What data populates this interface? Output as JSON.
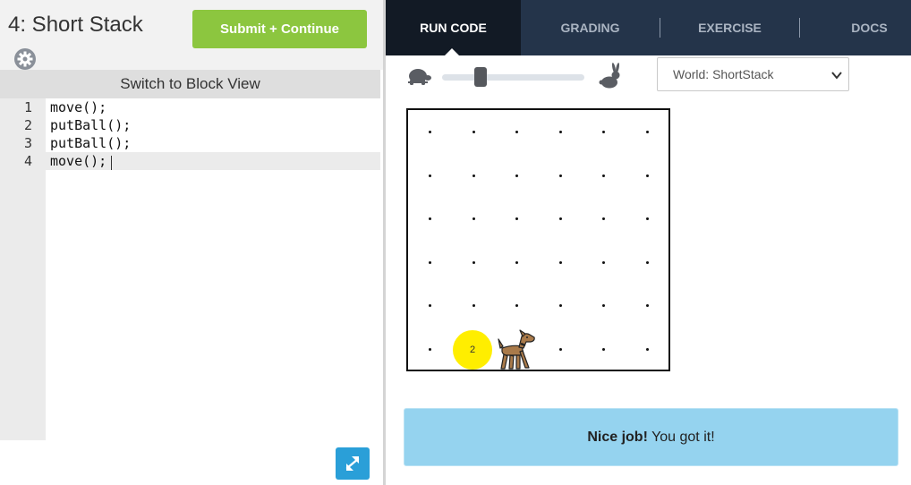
{
  "lesson": {
    "title": "4: Short Stack",
    "submit_label": "Submit + Continue",
    "switch_view_label": "Switch to Block View"
  },
  "editor": {
    "lines": [
      {
        "num": "1",
        "code": "move();"
      },
      {
        "num": "2",
        "code": "putBall();"
      },
      {
        "num": "3",
        "code": "putBall();"
      },
      {
        "num": "4",
        "code": "move();"
      }
    ],
    "active_line": 4
  },
  "tabs": [
    {
      "label": "RUN CODE",
      "active": true
    },
    {
      "label": "GRADING",
      "active": false
    },
    {
      "label": "EXERCISE",
      "active": false
    },
    {
      "label": "DOCS",
      "active": false
    }
  ],
  "controls": {
    "speed_fraction": 0.25,
    "world_select": {
      "selected": "World: ShortStack"
    }
  },
  "world": {
    "rows": 6,
    "cols": 6,
    "ball": {
      "row": 6,
      "col": 2,
      "count": "2"
    },
    "karel": {
      "row": 6,
      "col": 3,
      "facing": "east"
    }
  },
  "feedback": {
    "strong": "Nice job!",
    "text": " You got it!"
  },
  "icons": {
    "settings": "gear-icon",
    "expand": "expand-icon",
    "slow": "turtle-icon",
    "fast": "rabbit-icon",
    "dropdown": "chevron-down-icon"
  },
  "colors": {
    "submit": "#8cc63f",
    "tabs_bg": "#24344a",
    "tab_active": "#121a25",
    "feedback_bg": "#95d3ef",
    "ball": "#ffee00",
    "expand": "#2a9fd8"
  }
}
